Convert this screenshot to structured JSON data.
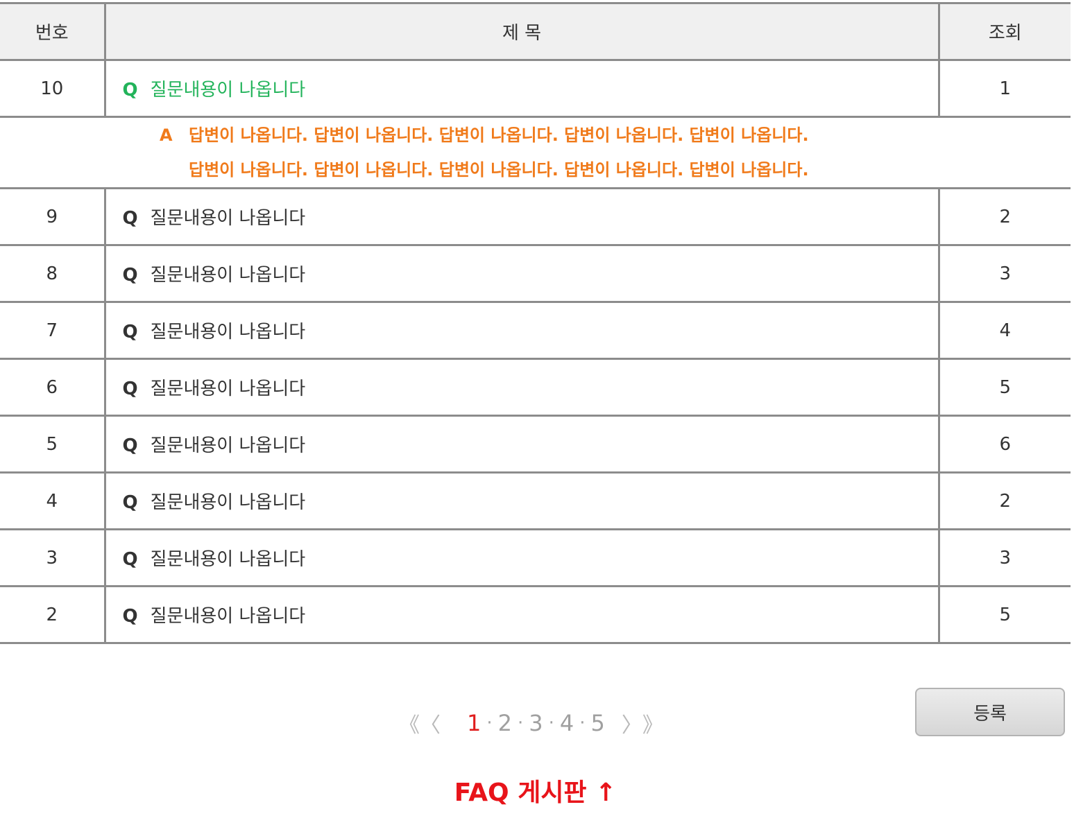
{
  "table": {
    "headers": {
      "number": "번호",
      "title": "제 목",
      "views": "조회"
    },
    "active_row": {
      "number": "10",
      "q_mark": "Q",
      "title": "질문내용이 나옵니다",
      "views": "1"
    },
    "answer": {
      "a_mark": "A",
      "line1": "답변이 나옵니다. 답변이 나옵니다. 답변이 나옵니다. 답변이 나옵니다. 답변이 나옵니다.",
      "line2": "답변이 나옵니다. 답변이 나옵니다. 답변이 나옵니다. 답변이 나옵니다. 답변이 나옵니다."
    },
    "rows": [
      {
        "number": "9",
        "q_mark": "Q",
        "title": "질문내용이 나옵니다",
        "views": "2"
      },
      {
        "number": "8",
        "q_mark": "Q",
        "title": "질문내용이 나옵니다",
        "views": "3"
      },
      {
        "number": "7",
        "q_mark": "Q",
        "title": "질문내용이 나옵니다",
        "views": "4"
      },
      {
        "number": "6",
        "q_mark": "Q",
        "title": "질문내용이 나옵니다",
        "views": "5"
      },
      {
        "number": "5",
        "q_mark": "Q",
        "title": "질문내용이 나옵니다",
        "views": "6"
      },
      {
        "number": "4",
        "q_mark": "Q",
        "title": "질문내용이 나옵니다",
        "views": "2"
      },
      {
        "number": "3",
        "q_mark": "Q",
        "title": "질문내용이 나옵니다",
        "views": "3"
      },
      {
        "number": "2",
        "q_mark": "Q",
        "title": "질문내용이 나옵니다",
        "views": "5"
      }
    ]
  },
  "pagination": {
    "first": "《",
    "prev": "〈",
    "pages": [
      "1",
      "2",
      "3",
      "4",
      "5"
    ],
    "current": "1",
    "separator": "·",
    "next": "〉",
    "last": "》"
  },
  "register_button": "등록",
  "caption": "FAQ 게시판 ↑",
  "colors": {
    "question_active": "#22b35a",
    "answer": "#f07a1a",
    "current_page": "#e01e1e",
    "caption": "#e8141a",
    "border": "#8c8c8c"
  }
}
